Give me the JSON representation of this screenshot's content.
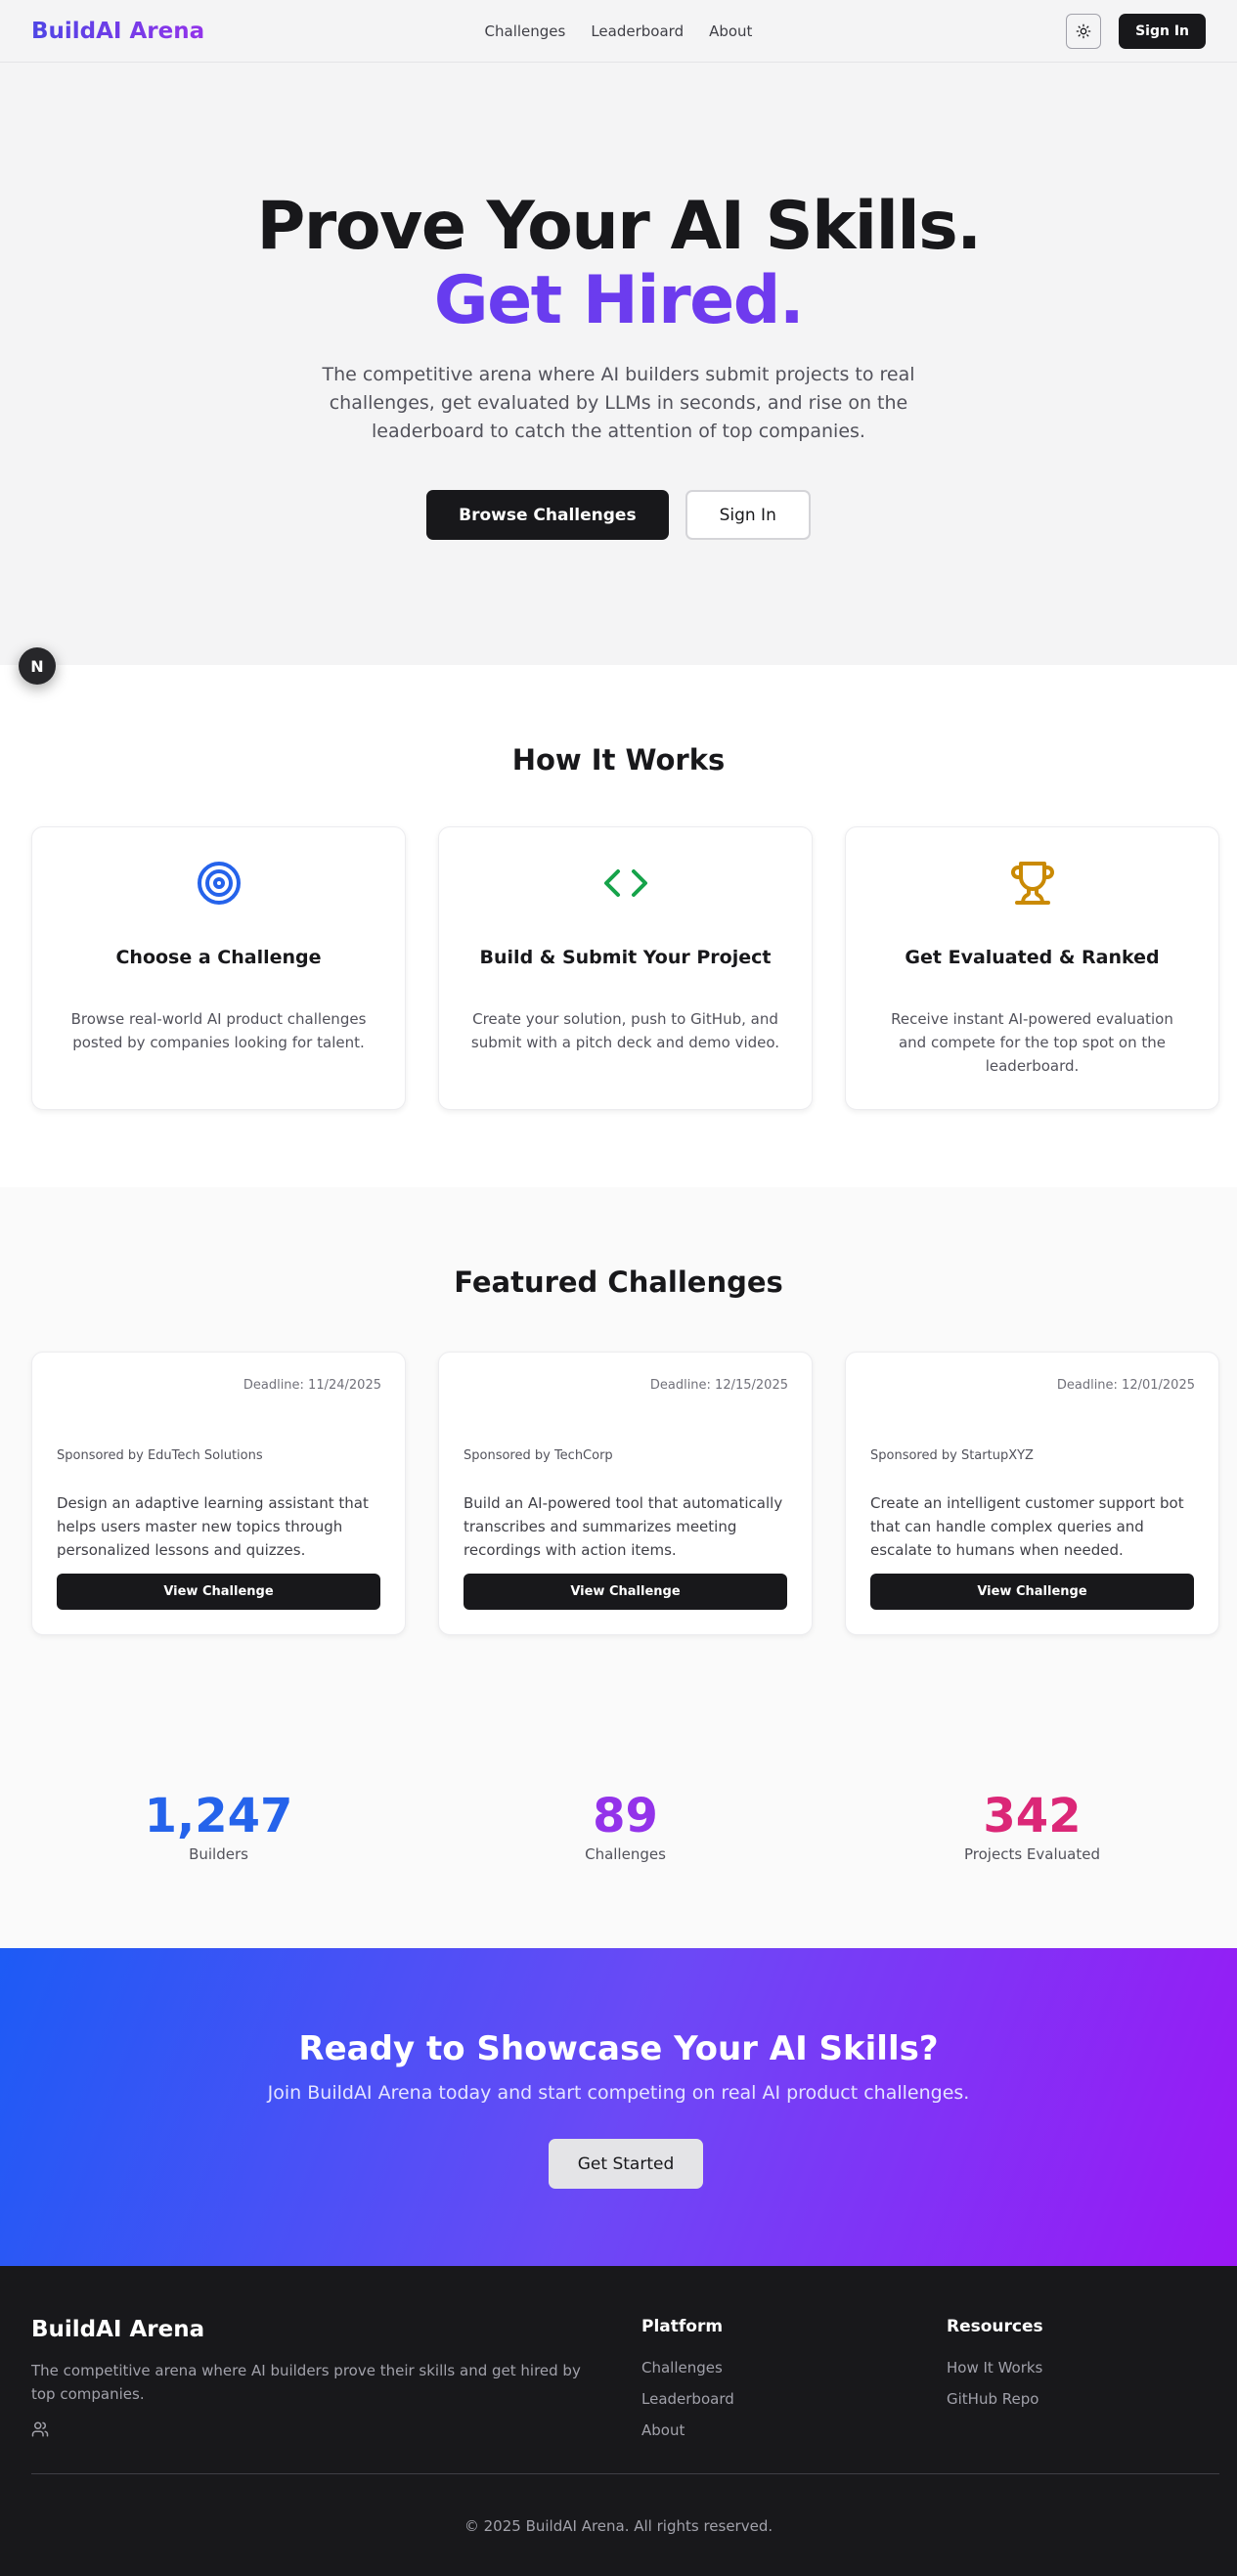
{
  "nav": {
    "brand": "BuildAI Arena",
    "links": [
      "Challenges",
      "Leaderboard",
      "About"
    ],
    "theme_icon": "sun-icon",
    "sign_in": "Sign In"
  },
  "hero": {
    "title_line1": "Prove Your AI Skills.",
    "title_line2": "Get Hired.",
    "subtitle": "The competitive arena where AI builders submit projects to real challenges, get evaluated by LLMs in seconds, and rise on the leaderboard to catch the attention of top companies.",
    "primary_button": "Browse Challenges",
    "secondary_button": "Sign In",
    "floating_badge": "N"
  },
  "how": {
    "title": "How It Works",
    "cards": [
      {
        "icon": "target-icon",
        "title": "Choose a Challenge",
        "text": "Browse real-world AI product challenges posted by companies looking for talent."
      },
      {
        "icon": "code-icon",
        "title": "Build & Submit Your Project",
        "text": "Create your solution, push to GitHub, and submit with a pitch deck and demo video."
      },
      {
        "icon": "trophy-icon",
        "title": "Get Evaluated & Ranked",
        "text": "Receive instant AI-powered evaluation and compete for the top spot on the leaderboard."
      }
    ]
  },
  "featured": {
    "title": "Featured Challenges",
    "cards": [
      {
        "deadline": "Deadline: 11/24/2025",
        "sponsor": "Sponsored by EduTech Solutions",
        "description": "Design an adaptive learning assistant that helps users master new topics through personalized lessons and quizzes.",
        "button": "View Challenge"
      },
      {
        "deadline": "Deadline: 12/15/2025",
        "sponsor": "Sponsored by TechCorp",
        "description": "Build an AI-powered tool that automatically transcribes and summarizes meeting recordings with action items.",
        "button": "View Challenge"
      },
      {
        "deadline": "Deadline: 12/01/2025",
        "sponsor": "Sponsored by StartupXYZ",
        "description": "Create an intelligent customer support bot that can handle complex queries and escalate to humans when needed.",
        "button": "View Challenge"
      }
    ]
  },
  "stats": [
    {
      "value": "1,247",
      "label": "Builders",
      "color": "#2563eb"
    },
    {
      "value": "89",
      "label": "Challenges",
      "color": "#9333ea"
    },
    {
      "value": "342",
      "label": "Projects Evaluated",
      "color": "#db2777"
    }
  ],
  "cta": {
    "title": "Ready to Showcase Your AI Skills?",
    "subtitle": "Join BuildAI Arena today and start competing on real AI product challenges.",
    "button": "Get Started"
  },
  "footer": {
    "brand": "BuildAI Arena",
    "tagline": "The competitive arena where AI builders prove their skills and get hired by top companies.",
    "social_icon": "users-icon",
    "platform": {
      "title": "Platform",
      "links": [
        "Challenges",
        "Leaderboard",
        "About"
      ]
    },
    "resources": {
      "title": "Resources",
      "links": [
        "How It Works",
        "GitHub Repo"
      ]
    },
    "copyright": "© 2025 BuildAI Arena. All rights reserved."
  },
  "colors": {
    "brand_gradient_start": "#4f46e5",
    "brand_gradient_end": "#9333ea",
    "cta_gradient_start": "#1d5bf5",
    "cta_gradient_end": "#9a18f5",
    "dark": "#18181b"
  }
}
